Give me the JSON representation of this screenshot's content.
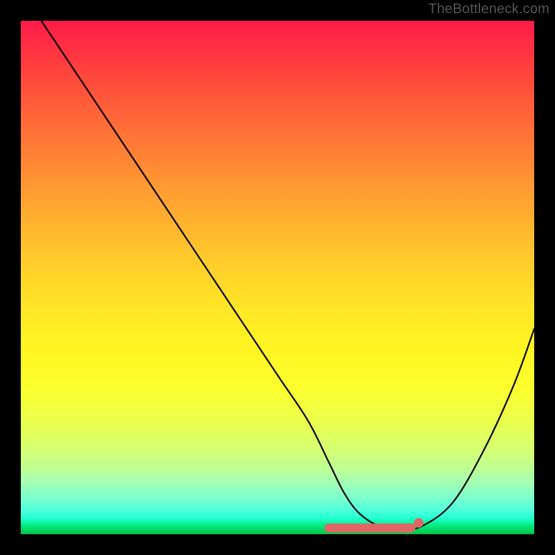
{
  "watermark": "TheBottleneck.com",
  "chart_data": {
    "type": "line",
    "title": "",
    "xlabel": "",
    "ylabel": "",
    "xlim": [
      0,
      100
    ],
    "ylim": [
      0,
      100
    ],
    "series": [
      {
        "name": "curve",
        "x": [
          4,
          10,
          20,
          30,
          40,
          50,
          56,
          60,
          63,
          66,
          70,
          74,
          78,
          84,
          90,
          96,
          100
        ],
        "y": [
          100,
          91,
          76,
          61,
          46,
          31,
          22,
          14,
          8,
          4,
          1.5,
          1,
          1.5,
          6,
          16,
          29,
          40
        ]
      }
    ],
    "markers": {
      "flat_segment": {
        "x_start": 60,
        "x_end": 76,
        "y": 1.2
      },
      "end_dot": {
        "x": 77.5,
        "y": 2.2
      }
    },
    "colors": {
      "gradient_top": "#ff1a4a",
      "gradient_bottom": "#00c24a",
      "curve": "#000000",
      "marker": "#e06666",
      "background": "#000000"
    }
  }
}
